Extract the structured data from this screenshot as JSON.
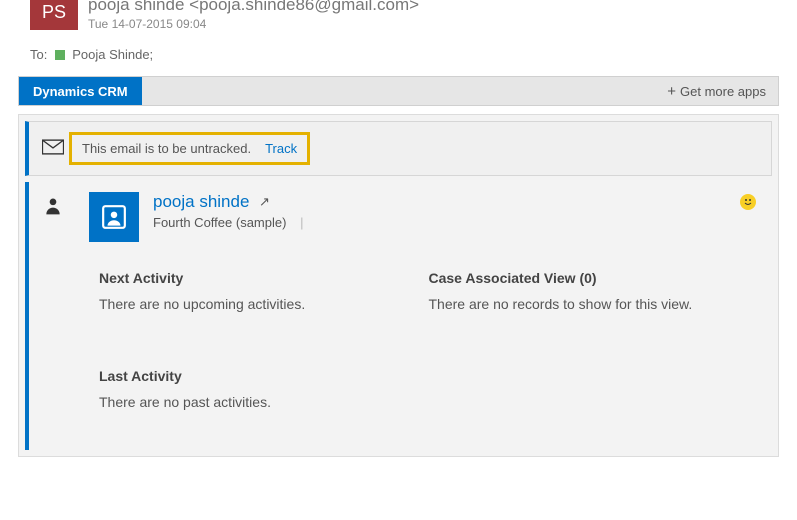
{
  "sender": {
    "initials": "PS",
    "display": "pooja shinde <pooja.shinde86@gmail.com>",
    "timestamp": "Tue 14-07-2015 09:04"
  },
  "to": {
    "label": "To:",
    "recipients": "Pooja Shinde;"
  },
  "tabs": {
    "active": "Dynamics CRM",
    "get_more": "Get more apps"
  },
  "messageBar": {
    "text": "This email is to be untracked.",
    "track_label": "Track"
  },
  "contact": {
    "name": "pooja shinde",
    "company": "Fourth Coffee (sample)"
  },
  "columns": {
    "next_activity": {
      "title": "Next Activity",
      "body": "There are no upcoming activities."
    },
    "cases": {
      "title": "Case Associated View (0)",
      "body": "There are no records to show for this view."
    },
    "last_activity": {
      "title": "Last Activity",
      "body": "There are no past activities."
    }
  }
}
